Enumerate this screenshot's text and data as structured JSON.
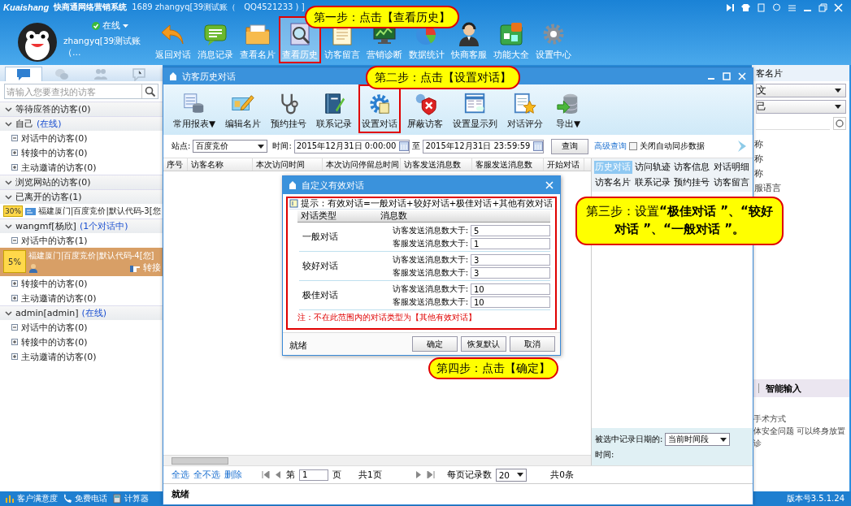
{
  "app": {
    "logo": "Kuaishang",
    "title": "快商通网络营销系统",
    "account": "1689 zhangyq[39测试账（　QQ4521233 ) ]"
  },
  "user": {
    "status": "在线",
    "name": "zhangyq[39测试账（…"
  },
  "toolbar": [
    {
      "label": "返回对话",
      "highlighted": false
    },
    {
      "label": "消息记录",
      "highlighted": false
    },
    {
      "label": "查看名片",
      "highlighted": false
    },
    {
      "label": "查看历史",
      "highlighted": true
    },
    {
      "label": "访客留言",
      "highlighted": false
    },
    {
      "label": "营销诊断",
      "highlighted": false
    },
    {
      "label": "数据统计",
      "highlighted": false
    },
    {
      "label": "快商客服",
      "highlighted": false
    },
    {
      "label": "功能大全",
      "highlighted": false
    },
    {
      "label": "设置中心",
      "highlighted": false
    }
  ],
  "sidebar": {
    "tabs": [
      {
        "selected": true
      },
      {
        "selected": false
      },
      {
        "selected": false
      },
      {
        "selected": false
      }
    ],
    "search": {
      "placeholder": "请输入您要查找的访客"
    },
    "groups": [
      {
        "label": "等待应答的访客(0)"
      },
      {
        "label": "自己",
        "status": "(在线)",
        "children": [
          {
            "kind": "subgroup",
            "label": "对话中的访客(0)",
            "expanded": true
          },
          {
            "kind": "subgroup",
            "label": "转接中的访客(0)",
            "expanded": false
          },
          {
            "kind": "subgroup",
            "label": "主动邀请的访客(0)",
            "expanded": false
          }
        ]
      },
      {
        "label": "浏览网站的访客(0)"
      },
      {
        "label": "已离开的访客(1)",
        "children": [
          {
            "kind": "visitor",
            "badge": "30%",
            "label": "福建厦门|百度竞价|默认代码-3[您",
            "selected": false
          }
        ]
      },
      {
        "label": "wangmf[杨欣]",
        "status": "(1个对话中)",
        "children": [
          {
            "kind": "subgroup",
            "label": "对话中的访客(1)",
            "expanded": true,
            "children": [
              {
                "kind": "visitor",
                "badge": "5%",
                "label": "福建厦门|百度竞价|默认代码-4[您]",
                "action": "转接",
                "selected": true
              }
            ]
          },
          {
            "kind": "subgroup",
            "label": "转接中的访客(0)",
            "expanded": false
          },
          {
            "kind": "subgroup",
            "label": "主动邀请的访客(0)",
            "expanded": false
          }
        ]
      },
      {
        "label": "admin[admin]",
        "status": "(在线)",
        "children": [
          {
            "kind": "subgroup",
            "label": "对话中的访客(0)",
            "expanded": true
          },
          {
            "kind": "subgroup",
            "label": "转接中的访客(0)",
            "expanded": false
          },
          {
            "kind": "subgroup",
            "label": "主动邀请的访客(0)",
            "expanded": false
          }
        ]
      }
    ]
  },
  "visitor_card_panel": {
    "title": "客名片",
    "select_1": "文",
    "select_2": "己",
    "items": [
      "称",
      "称",
      "称",
      "服语言"
    ],
    "tab": "智能输入",
    "lines": [
      "手术方式",
      "体安全问题  可以终身放置",
      "诊"
    ]
  },
  "status_bar": {
    "items": [
      "客户满意度",
      "免费电话",
      "计算器"
    ],
    "version": "版本号3.5.1.24"
  },
  "history_window": {
    "title": "访客历史对话",
    "toolbar": [
      {
        "label": "常用报表▼",
        "highlighted": false
      },
      {
        "label": "编辑名片",
        "highlighted": false
      },
      {
        "label": "预约挂号",
        "highlighted": false
      },
      {
        "label": "联系记录",
        "highlighted": false
      },
      {
        "label": "设置对话",
        "highlighted": true
      },
      {
        "label": "屏蔽访客",
        "highlighted": false
      },
      {
        "label": "设置显示列",
        "highlighted": false
      },
      {
        "label": "对话评分",
        "highlighted": false
      },
      {
        "label": "导出▼",
        "highlighted": false
      }
    ],
    "filter": {
      "site_label": "站点:",
      "site": "百度竞价",
      "time_label": "时间:",
      "from": "2015年12月31日  0:00:00",
      "to_label": "至",
      "to": "2015年12月31日  23:59:59",
      "query": "查询",
      "advanced": "高级查询",
      "sync_label": "关闭自动同步数据",
      "sync_checked": false
    },
    "table": {
      "columns": [
        "序号",
        "访客名称",
        "本次访问时间",
        "本次访问停留总时间",
        "访客发送消息数",
        "客服发送消息数",
        "开始对话"
      ]
    },
    "detail_tabs": [
      {
        "label": "历史对话",
        "selected": true
      },
      {
        "label": "访问轨迹",
        "selected": false
      },
      {
        "label": "访客信息",
        "selected": false
      },
      {
        "label": "对话明细",
        "selected": false
      },
      {
        "label": "访客名片",
        "selected": false
      },
      {
        "label": "联系记录",
        "selected": false
      },
      {
        "label": "预约挂号",
        "selected": false
      },
      {
        "label": "访客留言",
        "selected": false
      }
    ],
    "date_filter": {
      "label": "被选中记录日期的:",
      "value": "当前时间段",
      "time_label": "时间:"
    },
    "pager": {
      "links": [
        "全选",
        "全不选",
        "删除"
      ],
      "page_prefix": "第",
      "page": "1",
      "page_suffix": "页",
      "total_pages": "共1页",
      "per_page_label": "每页记录数",
      "per_page": "20",
      "total": "共0条"
    },
    "status": "就绪"
  },
  "dialog": {
    "title": "自定义有效对话",
    "highlighted": true,
    "tip": "提示：有效对话=一般对话+较好对话+极佳对话+其他有效对话",
    "headers": [
      "对话类型",
      "消息数"
    ],
    "types": [
      {
        "label": "一般对话",
        "fields": [
          {
            "label": "访客发送消息数大于:",
            "value": "5"
          },
          {
            "label": "客服发送消息数大于:",
            "value": "1"
          }
        ]
      },
      {
        "label": "较好对话",
        "fields": [
          {
            "label": "访客发送消息数大于:",
            "value": "3"
          },
          {
            "label": "客服发送消息数大于:",
            "value": "3"
          }
        ]
      },
      {
        "label": "极佳对话",
        "fields": [
          {
            "label": "访客发送消息数大于:",
            "value": "10"
          },
          {
            "label": "客服发送消息数大于:",
            "value": "10"
          }
        ]
      }
    ],
    "note": "注：不在此范围内的对话类型为【其他有效对话】",
    "status": "就绪",
    "buttons": [
      "确定",
      "恢复默认",
      "取消"
    ]
  },
  "callouts": [
    {
      "text": "第一步：点击【查看历史】"
    },
    {
      "text": "第二步：点击【设置对话】"
    },
    {
      "text": "第三步：设置**“极佳对话 ”、“较好对话 ”、“一般对话 ”。**"
    },
    {
      "text": "第四步：点击【确定】"
    }
  ]
}
